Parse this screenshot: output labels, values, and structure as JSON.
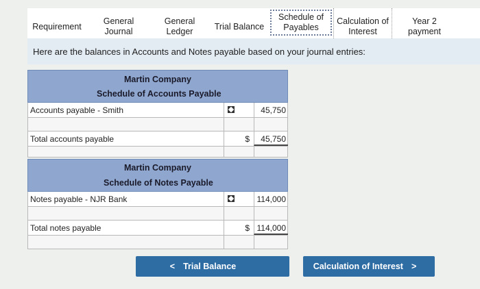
{
  "tabs": [
    {
      "label": "Requirement"
    },
    {
      "label": "General\nJournal"
    },
    {
      "label": "General\nLedger"
    },
    {
      "label": "Trial Balance"
    },
    {
      "label": "Schedule of\nPayables"
    },
    {
      "label": "Calculation of\nInterest"
    },
    {
      "label": "Year 2\npayment"
    }
  ],
  "info_text": "Here are the balances in Accounts and Notes payable based on your journal entries:",
  "accounts_schedule": {
    "company": "Martin Company",
    "title": "Schedule of Accounts Payable",
    "line_label": "Accounts payable - Smith",
    "line_value": "45,750",
    "total_label": "Total accounts payable",
    "currency": "$",
    "total_value": "45,750"
  },
  "notes_schedule": {
    "company": "Martin Company",
    "title": "Schedule of Notes Payable",
    "line_label": "Notes payable - NJR Bank",
    "line_value": "114,000",
    "total_label": "Total notes payable",
    "currency": "$",
    "total_value": "114,000"
  },
  "buttons": {
    "prev_label": "Trial Balance",
    "next_label": "Calculation of Interest"
  },
  "colors": {
    "header_bg": "#8fa7cf",
    "button_bg": "#2e6ca4"
  }
}
